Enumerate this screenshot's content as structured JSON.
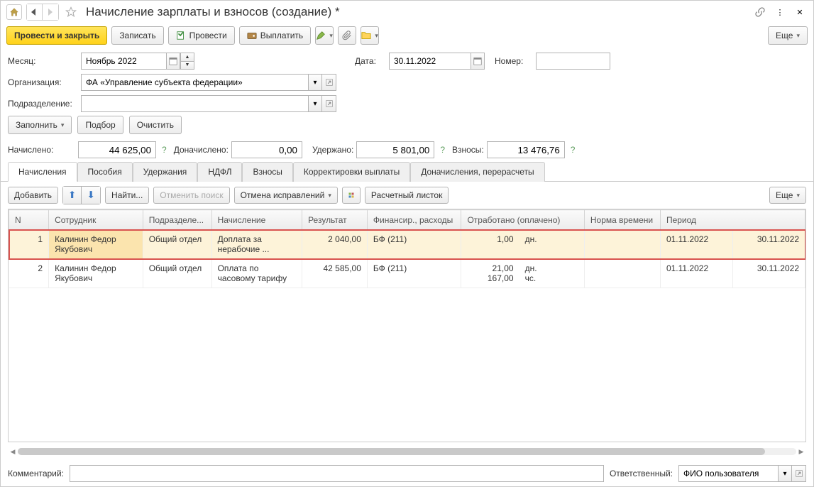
{
  "title": "Начисление зарплаты и взносов (создание) *",
  "toolbar": {
    "post_close": "Провести и закрыть",
    "write": "Записать",
    "post": "Провести",
    "pay": "Выплатить",
    "more": "Еще"
  },
  "form": {
    "month_lbl": "Месяц:",
    "month_val": "Ноябрь 2022",
    "date_lbl": "Дата:",
    "date_val": "30.11.2022",
    "number_lbl": "Номер:",
    "number_val": "",
    "org_lbl": "Организация:",
    "org_val": "ФА «Управление субъекта федерации»",
    "dept_lbl": "Подразделение:",
    "dept_val": ""
  },
  "actions": {
    "fill": "Заполнить",
    "select": "Подбор",
    "clear": "Очистить"
  },
  "summary": {
    "accrued_lbl": "Начислено:",
    "accrued_val": "44 625,00",
    "extra_lbl": "Доначислено:",
    "extra_val": "0,00",
    "withheld_lbl": "Удержано:",
    "withheld_val": "5 801,00",
    "contrib_lbl": "Взносы:",
    "contrib_val": "13 476,76"
  },
  "tabs": [
    "Начисления",
    "Пособия",
    "Удержания",
    "НДФЛ",
    "Взносы",
    "Корректировки выплаты",
    "Доначисления, перерасчеты"
  ],
  "tab_toolbar": {
    "add": "Добавить",
    "find": "Найти...",
    "cancel_search": "Отменить поиск",
    "undo_fix": "Отмена исправлений",
    "payslip": "Расчетный листок",
    "more": "Еще"
  },
  "grid": {
    "cols": [
      "N",
      "Сотрудник",
      "Подразделе...",
      "Начисление",
      "Результат",
      "Финансир., расходы",
      "Отработано (оплачено)",
      "Норма времени",
      "Период",
      ""
    ],
    "rows": [
      {
        "n": "1",
        "emp": "Калинин Федор Якубович",
        "dept": "Общий отдел",
        "accr": "Доплата за нерабочие ...",
        "res": "2 040,00",
        "fin": "БФ (211)",
        "worked": "1,00",
        "worked_unit": "дн.",
        "norm": "",
        "p1": "01.11.2022",
        "p2": "30.11.2022",
        "selected": true
      },
      {
        "n": "2",
        "emp": "Калинин Федор Якубович",
        "dept": "Общий отдел",
        "accr": "Оплата по часовому тарифу",
        "res": "42 585,00",
        "fin": "БФ (211)",
        "worked": "21,00",
        "worked_unit": "дн.",
        "worked2": "167,00",
        "worked2_unit": "чс.",
        "norm": "",
        "p1": "01.11.2022",
        "p2": "30.11.2022",
        "selected": false
      }
    ]
  },
  "footer": {
    "comment_lbl": "Комментарий:",
    "comment_val": "",
    "resp_lbl": "Ответственный:",
    "resp_val": "ФИО пользователя"
  }
}
